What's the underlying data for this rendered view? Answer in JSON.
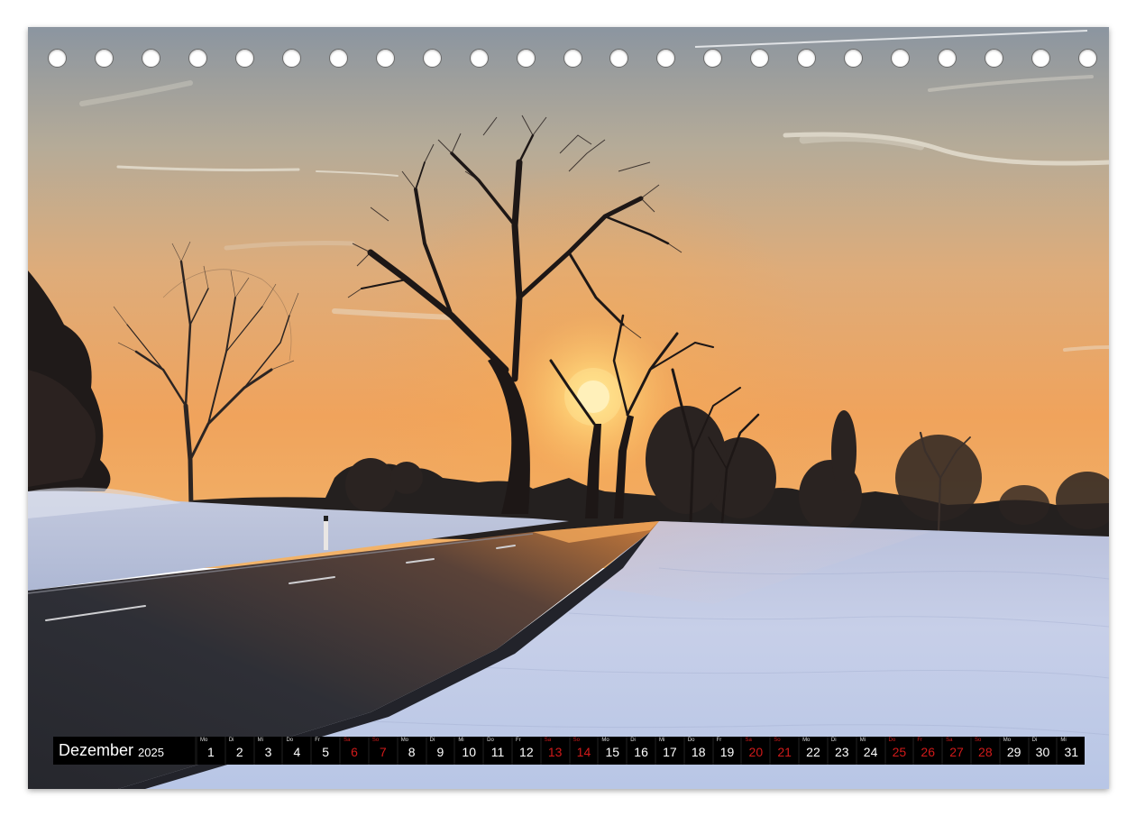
{
  "calendar": {
    "month": "Dezember",
    "year": "2025",
    "days": [
      {
        "wd": "Mo",
        "num": "1",
        "weekend": false
      },
      {
        "wd": "Di",
        "num": "2",
        "weekend": false
      },
      {
        "wd": "Mi",
        "num": "3",
        "weekend": false
      },
      {
        "wd": "Do",
        "num": "4",
        "weekend": false
      },
      {
        "wd": "Fr",
        "num": "5",
        "weekend": false
      },
      {
        "wd": "Sa",
        "num": "6",
        "weekend": true
      },
      {
        "wd": "So",
        "num": "7",
        "weekend": true
      },
      {
        "wd": "Mo",
        "num": "8",
        "weekend": false
      },
      {
        "wd": "Di",
        "num": "9",
        "weekend": false
      },
      {
        "wd": "Mi",
        "num": "10",
        "weekend": false
      },
      {
        "wd": "Do",
        "num": "11",
        "weekend": false
      },
      {
        "wd": "Fr",
        "num": "12",
        "weekend": false
      },
      {
        "wd": "Sa",
        "num": "13",
        "weekend": true
      },
      {
        "wd": "So",
        "num": "14",
        "weekend": true
      },
      {
        "wd": "Mo",
        "num": "15",
        "weekend": false
      },
      {
        "wd": "Di",
        "num": "16",
        "weekend": false
      },
      {
        "wd": "Mi",
        "num": "17",
        "weekend": false
      },
      {
        "wd": "Do",
        "num": "18",
        "weekend": false
      },
      {
        "wd": "Fr",
        "num": "19",
        "weekend": false
      },
      {
        "wd": "Sa",
        "num": "20",
        "weekend": true
      },
      {
        "wd": "So",
        "num": "21",
        "weekend": true
      },
      {
        "wd": "Mo",
        "num": "22",
        "weekend": false
      },
      {
        "wd": "Di",
        "num": "23",
        "weekend": false
      },
      {
        "wd": "Mi",
        "num": "24",
        "weekend": false
      },
      {
        "wd": "Do",
        "num": "25",
        "weekend": true
      },
      {
        "wd": "Fr",
        "num": "26",
        "weekend": true
      },
      {
        "wd": "Sa",
        "num": "27",
        "weekend": true
      },
      {
        "wd": "So",
        "num": "28",
        "weekend": true
      },
      {
        "wd": "Mo",
        "num": "29",
        "weekend": false
      },
      {
        "wd": "Di",
        "num": "30",
        "weekend": false
      },
      {
        "wd": "Mi",
        "num": "31",
        "weekend": false
      }
    ]
  },
  "binding": {
    "hole_count": 23
  },
  "colors": {
    "weekend": "#d11a1a",
    "strip_bg": "#000000",
    "sky_top": "#8d97a0",
    "sky_horizon": "#f2a457",
    "snow": "#c9d3ea",
    "road": "#2b2d33"
  }
}
